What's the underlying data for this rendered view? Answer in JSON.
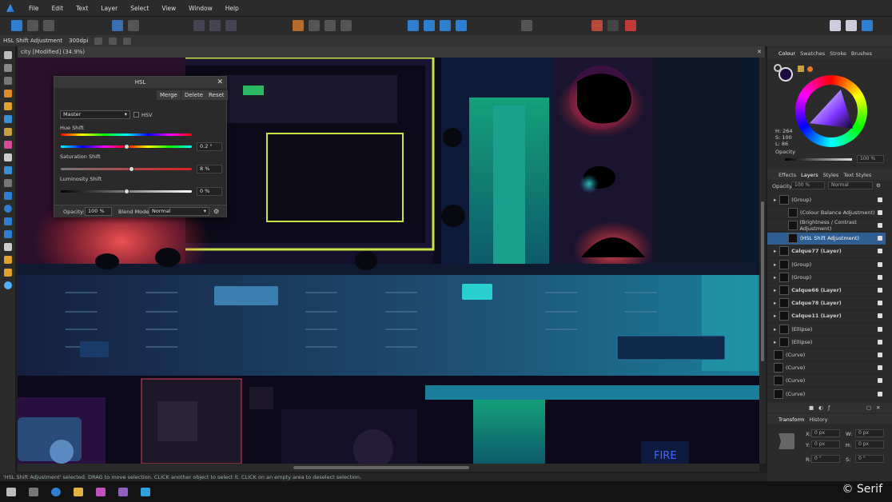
{
  "menu": [
    "File",
    "Edit",
    "Text",
    "Layer",
    "Select",
    "View",
    "Window",
    "Help"
  ],
  "context": {
    "label": "HSL Shift Adjustment",
    "dpi": "300dpi"
  },
  "document": {
    "title": "city [Modified] (34.9%)"
  },
  "dialog": {
    "title": "HSL",
    "buttons": {
      "merge": "Merge",
      "delete": "Delete",
      "reset": "Reset"
    },
    "channel": "Master",
    "hsv": "HSV",
    "hue": {
      "label": "Hue Shift",
      "value": "0.2 °",
      "level": 0.5
    },
    "saturation": {
      "label": "Saturation Shift",
      "value": "8 %",
      "level": 0.54
    },
    "luminosity": {
      "label": "Luminosity Shift",
      "value": "0 %",
      "level": 0.5
    },
    "opacity_label": "Opacity:",
    "opacity": "100 %",
    "blend_label": "Blend Mode:",
    "blend": "Normal"
  },
  "colour_panel": {
    "tabs": [
      "Colour",
      "Swatches",
      "Stroke",
      "Brushes"
    ],
    "h": "H: 264",
    "s": "S: 100",
    "l": "L: 86",
    "opacity_label": "Opacity",
    "opacity": "100 %"
  },
  "layers_panel": {
    "tabs": [
      "Effects",
      "Layers",
      "Styles",
      "Text Styles"
    ],
    "opacity_label": "Opacity:",
    "opacity": "100 %",
    "blend": "Normal",
    "rows": [
      "(Group)",
      "(Colour Balance Adjustment)",
      "(Brightness / Contrast Adjustment)",
      "(HSL Shift Adjustment)",
      "Calque77 (Layer)",
      "(Group)",
      "(Group)",
      "Calque66 (Layer)",
      "Calque78 (Layer)",
      "Calque11 (Layer)",
      "(Ellipse)",
      "(Ellipse)",
      "(Curve)",
      "(Curve)",
      "(Curve)",
      "(Curve)"
    ]
  },
  "transform_panel": {
    "tabs": [
      "Transform",
      "History"
    ],
    "x": "X:",
    "y": "Y:",
    "w": "W:",
    "h": "H:",
    "r": "R:",
    "s": "S:",
    "x_val": "0 px",
    "y_val": "0 px",
    "w_val": "0 px",
    "h_val": "0 px",
    "r_val": "0 °",
    "s_val": "0 °"
  },
  "status": "'HSL Shift Adjustment' selected. DRAG to move selection. CLICK another object to select it. CLICK on an empty area to deselect selection.",
  "copyright": "© Serif",
  "colors": {
    "accent": "#3a8fd9",
    "selected_row": "#2f5e92"
  }
}
